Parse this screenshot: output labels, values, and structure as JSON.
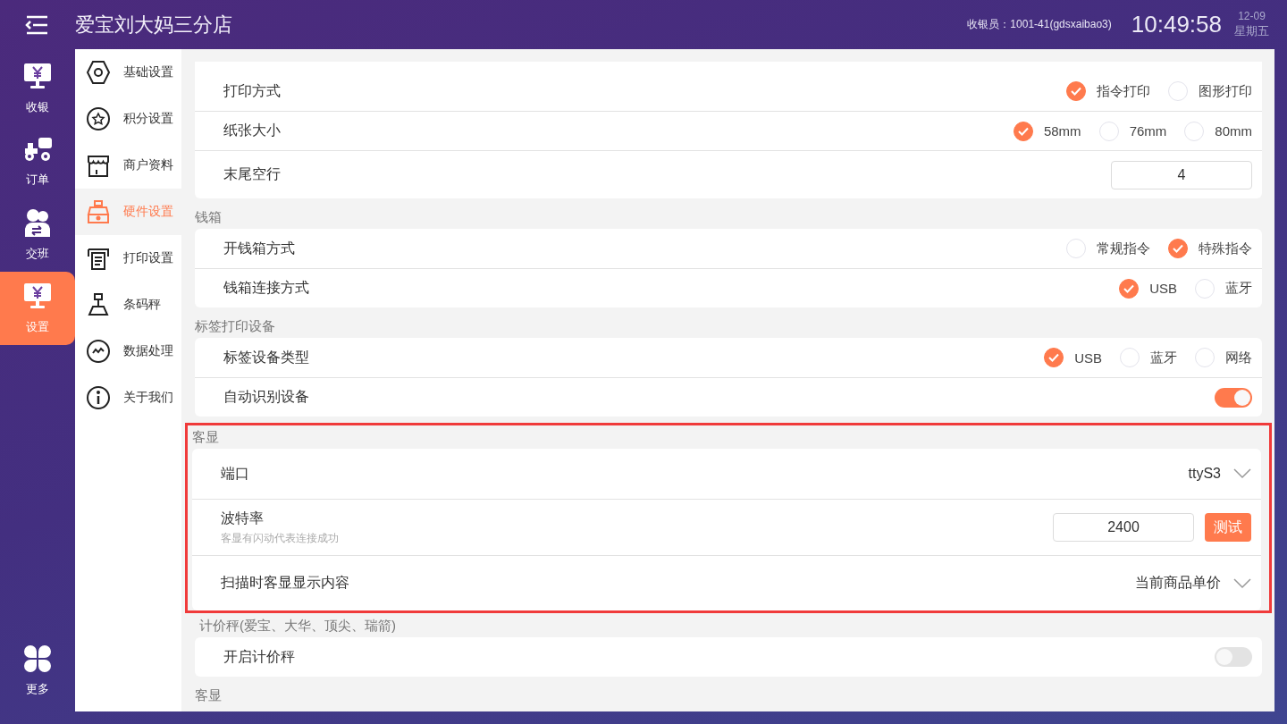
{
  "header": {
    "title": "爱宝刘大妈三分店",
    "cashier": "收银员：1001-41(gdsxaibao3)",
    "time": "10:49:58",
    "date": "12-09",
    "weekday": "星期五"
  },
  "nav": [
    {
      "label": "收银",
      "selected": false
    },
    {
      "label": "订单",
      "selected": false
    },
    {
      "label": "交班",
      "selected": false
    },
    {
      "label": "设置",
      "selected": true
    }
  ],
  "more": {
    "label": "更多"
  },
  "submenu": [
    {
      "label": "基础设置",
      "selected": false
    },
    {
      "label": "积分设置",
      "selected": false
    },
    {
      "label": "商户资料",
      "selected": false
    },
    {
      "label": "硬件设置",
      "selected": true
    },
    {
      "label": "打印设置",
      "selected": false
    },
    {
      "label": "条码秤",
      "selected": false
    },
    {
      "label": "数据处理",
      "selected": false
    },
    {
      "label": "关于我们",
      "selected": false
    }
  ],
  "sections": [
    {
      "highlighted": false,
      "rows": [
        {
          "kind": "radio",
          "label": "打印方式",
          "options": [
            {
              "label": "指令打印",
              "selected": true
            },
            {
              "label": "图形打印",
              "selected": false
            }
          ]
        },
        {
          "kind": "radio",
          "label": "纸张大小",
          "options": [
            {
              "label": "58mm",
              "selected": true
            },
            {
              "label": "76mm",
              "selected": false
            },
            {
              "label": "80mm",
              "selected": false
            }
          ]
        },
        {
          "kind": "input",
          "label": "末尾空行",
          "value": "4"
        }
      ]
    },
    {
      "title": "钱箱",
      "highlighted": false,
      "rows": [
        {
          "kind": "radio",
          "label": "开钱箱方式",
          "options": [
            {
              "label": "常规指令",
              "selected": false
            },
            {
              "label": "特殊指令",
              "selected": true
            }
          ]
        },
        {
          "kind": "radio",
          "label": "钱箱连接方式",
          "options": [
            {
              "label": "USB",
              "selected": true
            },
            {
              "label": "蓝牙",
              "selected": false
            }
          ]
        }
      ]
    },
    {
      "title": "标签打印设备",
      "highlighted": false,
      "rows": [
        {
          "kind": "radio",
          "label": "标签设备类型",
          "options": [
            {
              "label": "USB",
              "selected": true
            },
            {
              "label": "蓝牙",
              "selected": false
            },
            {
              "label": "网络",
              "selected": false
            }
          ]
        },
        {
          "kind": "toggle",
          "label": "自动识别设备",
          "on": true
        }
      ]
    },
    {
      "title": "客显",
      "highlighted": true,
      "rows": [
        {
          "kind": "select",
          "label": "端口",
          "value": "ttyS3"
        },
        {
          "kind": "input_button",
          "label": "波特率",
          "hint": "客显有闪动代表连接成功",
          "value": "2400",
          "button": "测试"
        },
        {
          "kind": "select",
          "label": "扫描时客显显示内容",
          "value": "当前商品单价"
        }
      ]
    },
    {
      "title": "计价秤(爱宝、大华、顶尖、瑞箭)",
      "highlighted": false,
      "rows": [
        {
          "kind": "toggle",
          "label": "开启计价秤",
          "on": false
        }
      ]
    },
    {
      "title": "客显",
      "highlighted": false
    }
  ]
}
